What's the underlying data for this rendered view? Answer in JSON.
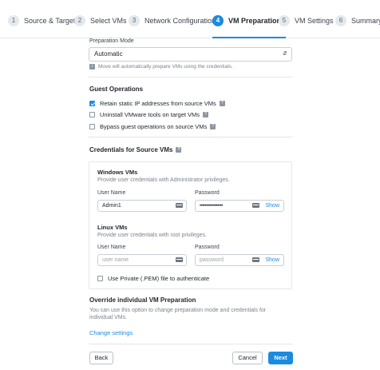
{
  "stepper": {
    "steps": [
      {
        "num": "1",
        "label": "Source & Target"
      },
      {
        "num": "2",
        "label": "Select VMs"
      },
      {
        "num": "3",
        "label": "Network Configuration"
      },
      {
        "num": "4",
        "label": "VM Preparation"
      },
      {
        "num": "5",
        "label": "VM Settings"
      },
      {
        "num": "6",
        "label": "Summary"
      }
    ],
    "active_step": "4"
  },
  "prep_mode": {
    "label": "Preparation Mode",
    "selected": "Automatic",
    "hint": "Move will automatically prepare VMs using the credentials."
  },
  "guest_ops": {
    "title": "Guest Operations",
    "options": [
      {
        "label": "Retain static IP addresses from source VMs",
        "checked": true
      },
      {
        "label": "Uninstall VMware tools on target VMs",
        "checked": false
      },
      {
        "label": "Bypass guest operations on source VMs",
        "checked": false
      }
    ]
  },
  "credentials": {
    "title": "Credentials for Source VMs",
    "windows": {
      "title": "Windows VMs",
      "desc": "Provide user credentials with Administrator privileges.",
      "username_label": "User Name",
      "username_value": "Admin1",
      "password_label": "Password",
      "password_value": "••••••••••••••••••",
      "show_label": "Show"
    },
    "linux": {
      "title": "Linux VMs",
      "desc": "Provide user credentials with root privileges.",
      "username_label": "User Name",
      "username_placeholder": "user name",
      "password_label": "Password",
      "password_placeholder": "password",
      "show_label": "Show",
      "pem_label": "Use Private (.PEM) file to authenticate",
      "pem_checked": false
    }
  },
  "override": {
    "title": "Override individual VM Preparation",
    "desc_line1": "You can use this option to change preparation mode and credentials for",
    "desc_line2": "individual VMs.",
    "link": "Change settings"
  },
  "footer": {
    "back": "Back",
    "cancel": "Cancel",
    "next": "Next"
  },
  "colors": {
    "accent": "#1b8be0",
    "border": "#c9cfd6"
  },
  "icons": {
    "select_caret": "up-down-caret-icon",
    "info": "info-icon",
    "password_manager": "key-icon"
  }
}
